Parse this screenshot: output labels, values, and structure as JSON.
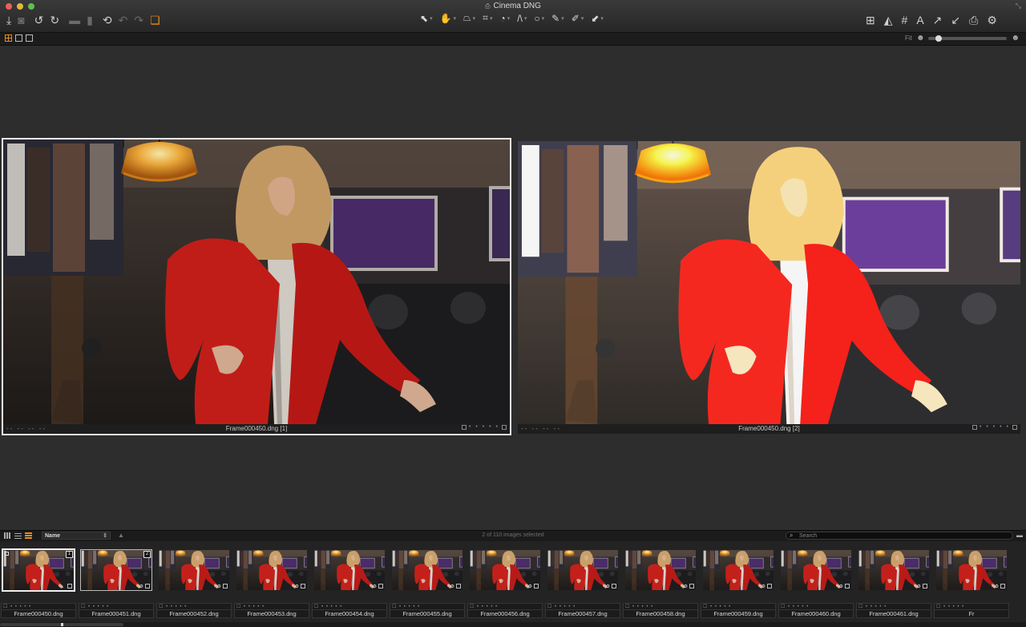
{
  "window": {
    "title": "Cinema DNG",
    "doc_icon": "⎙",
    "resize_icon": "⤡"
  },
  "toolbar": {
    "left_icons": [
      {
        "name": "import-icon",
        "glyph": "⤓",
        "state": "normal"
      },
      {
        "name": "camera-icon",
        "glyph": "◙",
        "state": "dim"
      },
      {
        "name": "rotate-left-icon",
        "glyph": "↺",
        "state": "normal"
      },
      {
        "name": "rotate-right-icon",
        "glyph": "↻",
        "state": "normal"
      },
      {
        "name": "folder-icon",
        "glyph": "▬",
        "state": "dim"
      },
      {
        "name": "trash-icon",
        "glyph": "▮",
        "state": "dim"
      },
      {
        "name": "revert-icon",
        "glyph": "⟲",
        "state": "normal"
      },
      {
        "name": "undo-icon",
        "glyph": "↶",
        "state": "dim"
      },
      {
        "name": "redo-icon",
        "glyph": "↷",
        "state": "dim"
      },
      {
        "name": "stack-icon",
        "glyph": "❏",
        "state": "orange"
      }
    ],
    "tools": [
      {
        "name": "select-tool-icon",
        "glyph": "⬉",
        "active": false
      },
      {
        "name": "hand-tool-icon",
        "glyph": "✋",
        "active": true
      },
      {
        "name": "keystone-tool-icon",
        "glyph": "⏢",
        "active": false
      },
      {
        "name": "crop-tool-icon",
        "glyph": "⌗",
        "active": false
      },
      {
        "name": "rotate-tool-icon",
        "glyph": "◔",
        "active": false
      },
      {
        "name": "lens-tool-icon",
        "glyph": "/\\",
        "active": false
      },
      {
        "name": "circle-tool-icon",
        "glyph": "○",
        "active": false
      },
      {
        "name": "brush-tool-icon",
        "glyph": "✎",
        "active": false
      },
      {
        "name": "eyedropper-tool-icon",
        "glyph": "✐",
        "active": false
      },
      {
        "name": "annotation-tool-icon",
        "glyph": "⬋",
        "active": false
      }
    ],
    "right_icons": [
      {
        "name": "layout-panels-icon",
        "glyph": "⊞"
      },
      {
        "name": "exposure-warning-icon",
        "glyph": "◭"
      },
      {
        "name": "grid-icon",
        "glyph": "#"
      },
      {
        "name": "text-icon",
        "glyph": "A"
      },
      {
        "name": "copy-adjustments-icon",
        "glyph": "↗"
      },
      {
        "name": "paste-adjustments-icon",
        "glyph": "↙"
      },
      {
        "name": "print-icon",
        "glyph": "⎙"
      },
      {
        "name": "settings-icon",
        "glyph": "⚙"
      }
    ]
  },
  "subbar": {
    "zoom_label": "Fit",
    "zoom_value": 0.1
  },
  "viewer": {
    "panes": [
      {
        "filename": "Frame000450.dng [1]",
        "dashes": "-- -- -- --",
        "stars": "• • • • •",
        "selected": true,
        "variant": "dark"
      },
      {
        "filename": "Frame000450.dng [2]",
        "dashes": "-- -- -- --",
        "stars": "• • • • •",
        "selected": false,
        "variant": "bright"
      }
    ]
  },
  "browser": {
    "sort_label": "Name",
    "sort_arrow": "⇕",
    "sort_direction": "▲",
    "selected_count": "2 of 110 images selected",
    "search_placeholder": "Search",
    "search_icon": "⌕",
    "menu_icon": "▬"
  },
  "filmstrip": {
    "star_row": "☐ • • • • •",
    "thumbnails": [
      {
        "name": "Frame000450.dng",
        "badge": "1",
        "state": "sel"
      },
      {
        "name": "Frame000451.dng",
        "badge": "2",
        "state": "sel2"
      },
      {
        "name": "Frame000452.dng",
        "badge": "",
        "state": ""
      },
      {
        "name": "Frame000453.dng",
        "badge": "",
        "state": ""
      },
      {
        "name": "Frame000454.dng",
        "badge": "",
        "state": ""
      },
      {
        "name": "Frame000455.dng",
        "badge": "",
        "state": ""
      },
      {
        "name": "Frame000456.dng",
        "badge": "",
        "state": ""
      },
      {
        "name": "Frame000457.dng",
        "badge": "",
        "state": ""
      },
      {
        "name": "Frame000458.dng",
        "badge": "",
        "state": ""
      },
      {
        "name": "Frame000459.dng",
        "badge": "",
        "state": ""
      },
      {
        "name": "Frame000460.dng",
        "badge": "",
        "state": ""
      },
      {
        "name": "Frame000461.dng",
        "badge": "",
        "state": ""
      },
      {
        "name": "Fr",
        "badge": "",
        "state": ""
      }
    ]
  }
}
